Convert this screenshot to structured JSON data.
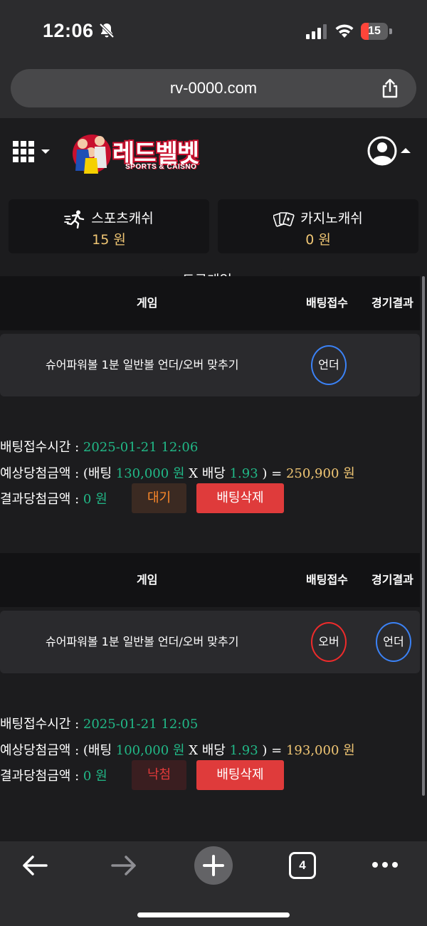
{
  "status_bar": {
    "time": "12:06",
    "battery": "15",
    "battery_level": 0.15
  },
  "browser": {
    "url": "rv-0000.com",
    "tab_count": "4"
  },
  "site": {
    "logo_text": "레드벨벳",
    "logo_sub": "SPORTS & CAISNO"
  },
  "cash": {
    "sports": {
      "label": "스포츠캐쉬",
      "amount": "15 원"
    },
    "casino": {
      "label": "카지노캐쉬",
      "amount": "0 원"
    }
  },
  "table_headers": {
    "game": "게임",
    "bet": "배팅접수",
    "result": "경기결과"
  },
  "labels": {
    "bet_time": "배팅접수시간 :",
    "expected": "예상당첨금액 : (배팅",
    "x_odds": "X 배당",
    "close_eq": ") =",
    "result_amount": "결과당첨금액 :",
    "delete": "배팅삭제"
  },
  "bets": [
    {
      "game": "슈어파워볼 1분 일반볼 언더/오버 맞추기",
      "pick": "언더",
      "result": "",
      "time": "2025-01-21 12:06",
      "stake": "130,000 원",
      "odds": "1.93",
      "expected": "250,900 원",
      "result_amount": "0 원",
      "status": "대기"
    },
    {
      "game": "슈어파워볼 1분 일반볼 언더/오버 맞추기",
      "pick": "오버",
      "result": "언더",
      "time": "2025-01-21 12:05",
      "stake": "100,000 원",
      "odds": "1.93",
      "expected": "193,000 원",
      "result_amount": "0 원",
      "status": "낙첨"
    }
  ],
  "tab_peek": "토큰게임"
}
